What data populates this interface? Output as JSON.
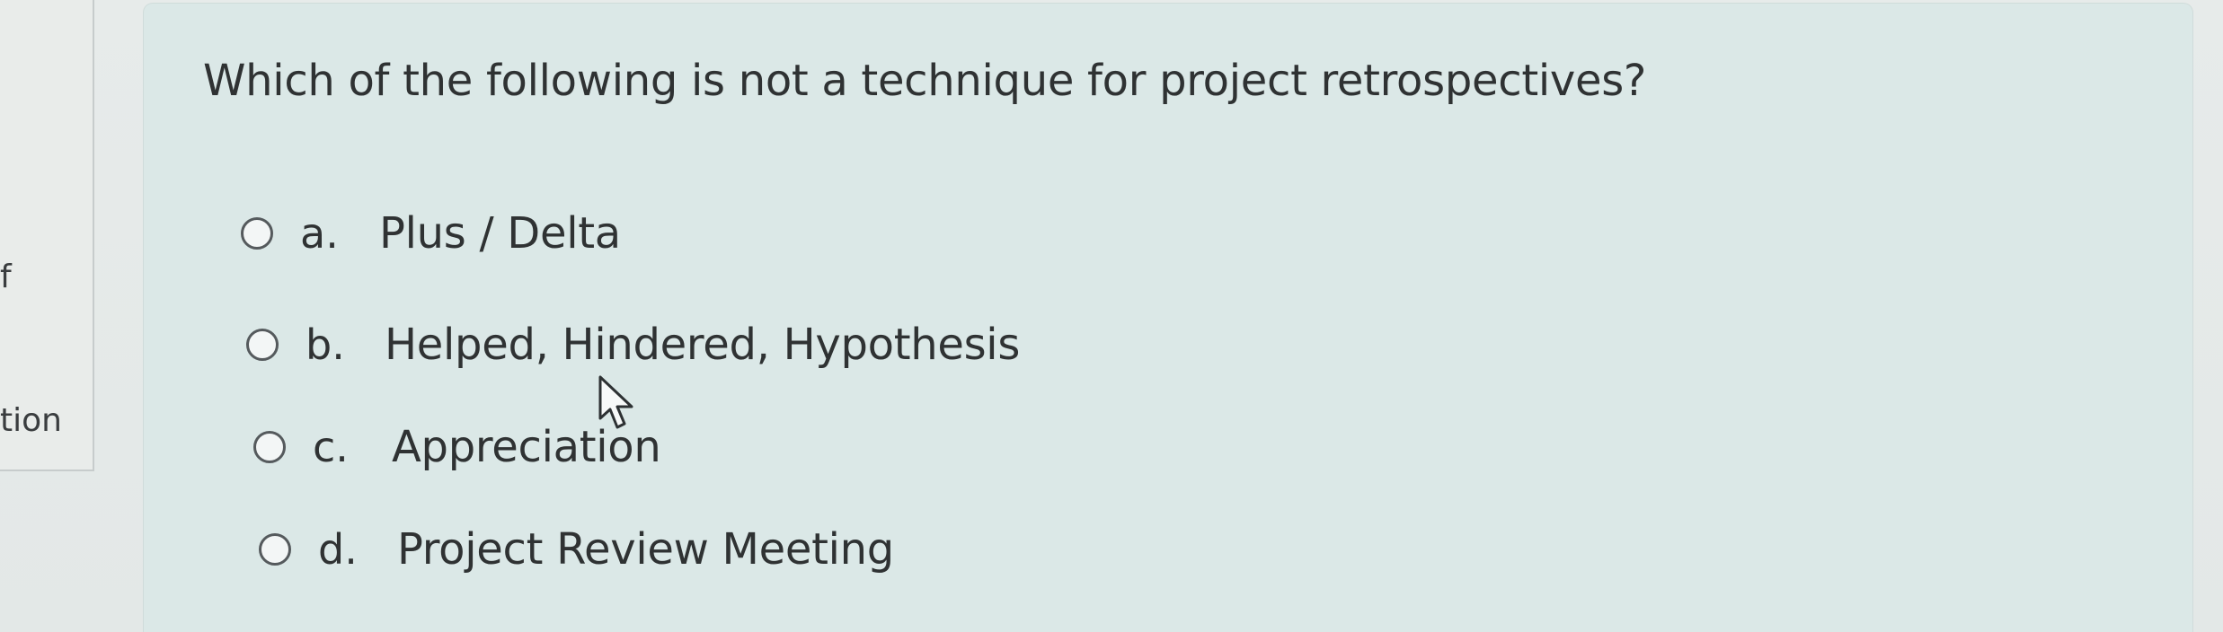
{
  "left_panel": {
    "line1": "f",
    "line2": "tion"
  },
  "question": {
    "text": "Which of the following is not a technique for project retrospectives?"
  },
  "options": [
    {
      "letter": "a.",
      "text": "Plus / Delta"
    },
    {
      "letter": "b.",
      "text": "Helped, Hindered, Hypothesis"
    },
    {
      "letter": "c.",
      "text": "Appreciation"
    },
    {
      "letter": "d.",
      "text": "Project Review Meeting"
    }
  ],
  "icons": {
    "radio": "radio-button-icon",
    "cursor": "mouse-pointer-icon"
  }
}
